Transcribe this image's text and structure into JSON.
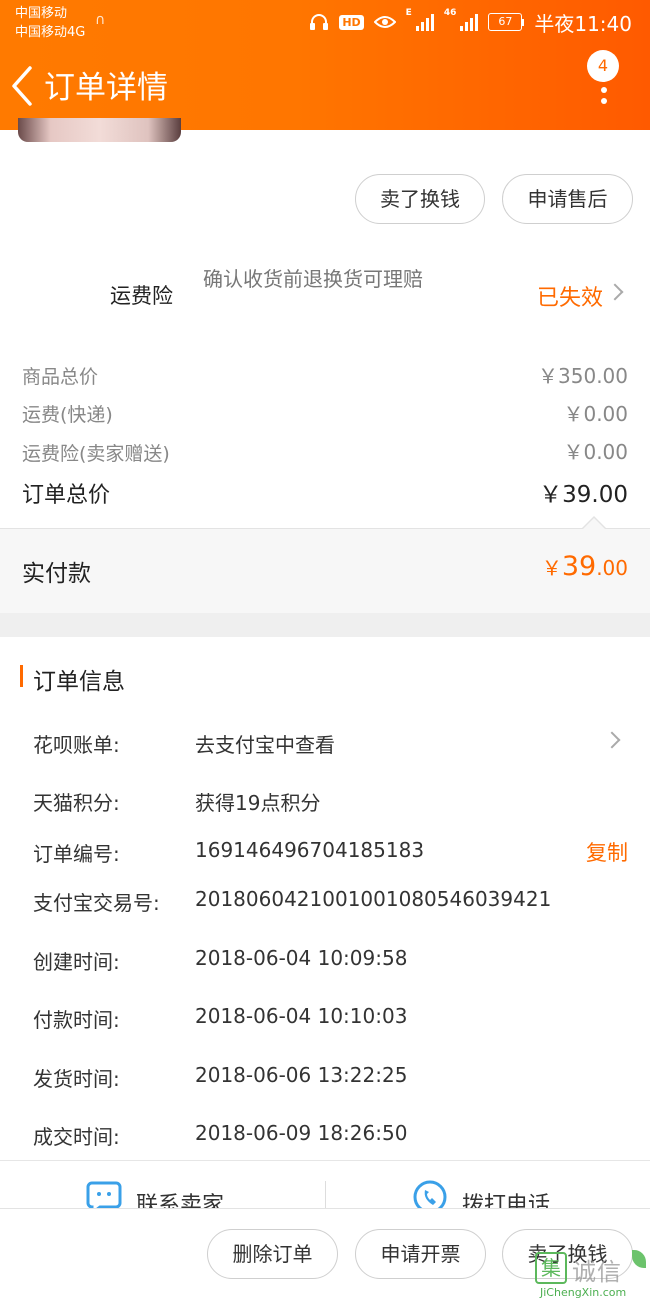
{
  "status_bar": {
    "carrier1": "中国移动",
    "carrier2": "中国移动4G",
    "net_type": "46",
    "net_e": "E",
    "hd": "HD",
    "battery": "67",
    "time": "半夜11:40"
  },
  "header": {
    "title": "订单详情",
    "more_badge": "4"
  },
  "actions_top": {
    "sell_exchange": "卖了换钱",
    "after_sale": "申请售后"
  },
  "insurance": {
    "label": "运费险",
    "desc": "确认收货前退换货可理赔",
    "status": "已失效"
  },
  "price": {
    "goods_total_label": "商品总价",
    "goods_total_value": "￥350.00",
    "shipping_label": "运费(快递)",
    "shipping_value": "￥0.00",
    "insurance_label": "运费险(卖家赠送)",
    "insurance_value": "￥0.00",
    "order_total_label": "订单总价",
    "order_total_value": "￥39.00",
    "paid_label": "实付款",
    "paid_symbol": "￥",
    "paid_int": "39",
    "paid_dec": ".00"
  },
  "order_info": {
    "title": "订单信息",
    "rows": [
      {
        "label": "花呗账单:",
        "value": "去支付宝中查看"
      },
      {
        "label": "天猫积分:",
        "value": "获得19点积分"
      },
      {
        "label": "订单编号:",
        "value": "169146496704185183",
        "action": "复制"
      },
      {
        "label": "支付宝交易号:",
        "value": "2018060421001001080546039421"
      },
      {
        "label": "创建时间:",
        "value": "2018-06-04 10:09:58"
      },
      {
        "label": "付款时间:",
        "value": "2018-06-04 10:10:03"
      },
      {
        "label": "发货时间:",
        "value": "2018-06-06 13:22:25"
      },
      {
        "label": "成交时间:",
        "value": "2018-06-09 18:26:50"
      }
    ]
  },
  "contact": {
    "seller": "联系卖家",
    "phone": "拨打电话"
  },
  "bottom_actions": {
    "delete": "删除订单",
    "invoice": "申请开票",
    "sell_exchange": "卖了换钱"
  },
  "watermark": {
    "icon_char": "集",
    "name": "诚信",
    "url": "JiChengXin.com"
  },
  "colors": {
    "accent": "#ff6a00",
    "header_bg": "#ff7600"
  }
}
